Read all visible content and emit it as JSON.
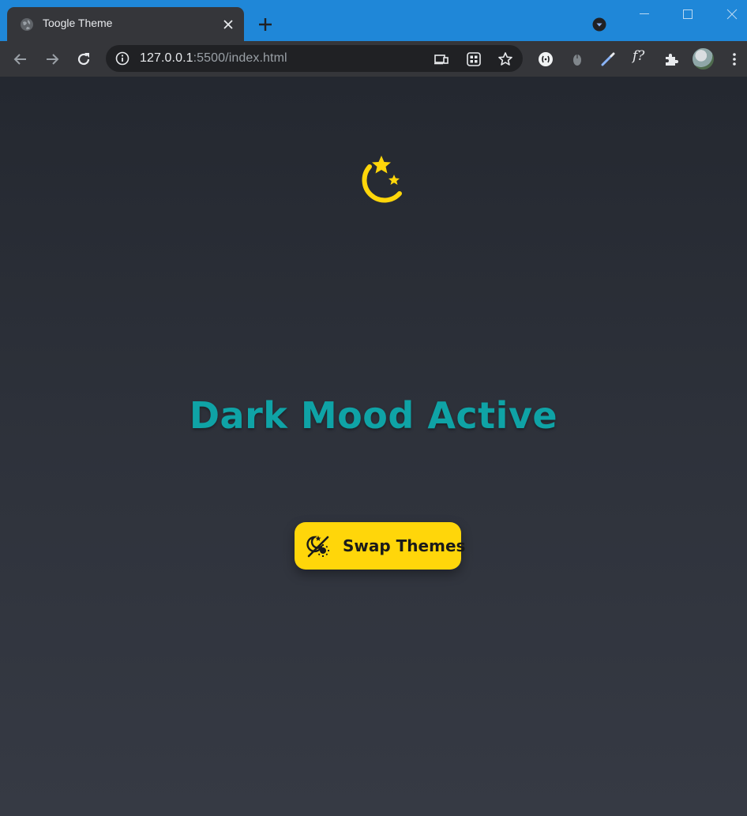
{
  "browser": {
    "tab": {
      "title": "Toogle Theme"
    },
    "omnibox": {
      "url_host": "127.0.0.1",
      "url_rest": ":5500/index.html"
    },
    "extension_label": "f?"
  },
  "page": {
    "heading": "Dark Mood Active",
    "button": {
      "label": "Swap Themes"
    },
    "icons": {
      "theme": "moon-stars-icon",
      "swap": "theme-toggle-icon"
    }
  },
  "colors": {
    "titlebar": "#1f87d8",
    "chrome": "#35363a",
    "accent_yellow": "#ffd60a",
    "heading_teal": "#0fa3a6",
    "page_bg": "#2a2e36"
  }
}
